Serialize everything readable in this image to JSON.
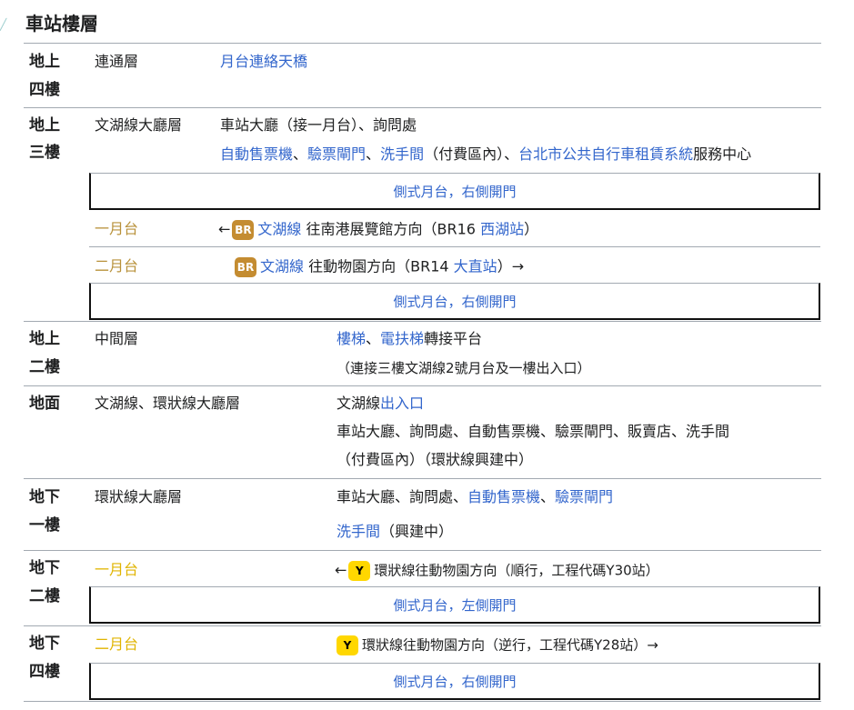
{
  "title": "車站樓層",
  "f4": {
    "floor_a": "地上",
    "floor_b": "四樓",
    "level": "連通層",
    "desc": "月台連絡天橋"
  },
  "f3": {
    "floor_a": "地上",
    "floor_b": "三樓",
    "level": "文湖線大廳層",
    "line1": "車站大廳（接一月台）、詢問處",
    "line2_links": [
      "自動售票機",
      "驗票閘門",
      "洗手間"
    ],
    "line2_sep1": "、",
    "line2_sep2": "、",
    "line2_plain1": "（付費區內）、",
    "line2_link4": "台北市公共自行車租賃系統",
    "line2_tail": "服務中心",
    "box1": "側式月台，右側開門",
    "p1_label": "一月台",
    "p1_arrow": "←",
    "p1_badge": "BR",
    "p1_line": "文湖線",
    "p1_dir": "往南港展覽館方向（BR16",
    "p1_station": "西湖站",
    "p1_end": "）",
    "p2_label": "二月台",
    "p2_badge": "BR",
    "p2_line": "文湖線",
    "p2_dir": "往動物園方向（BR14",
    "p2_station": "大直站",
    "p2_end": "）→",
    "box2": "側式月台，右側開門"
  },
  "f2": {
    "floor_a": "地上",
    "floor_b": "二樓",
    "level": "中間層",
    "desc_link1": "樓梯",
    "desc_sep": "、",
    "desc_link2": "電扶梯",
    "desc_tail": "轉接平台",
    "desc2": "（連接三樓文湖線2號月台及一樓出入口）"
  },
  "g": {
    "floor": "地面",
    "level": "文湖線、環狀線大廳層",
    "desc1_plain": "文湖線",
    "desc1_link": "出入口",
    "desc2": "車站大廳、詢問處、自動售票機、驗票閘門、販賣店、洗手間",
    "desc3": "（付費區內）（環狀線興建中）"
  },
  "b1": {
    "floor_a": "地下",
    "floor_b": "一樓",
    "level": "環狀線大廳層",
    "desc1_plain": "車站大廳、詢問處、",
    "desc1_link1": "自動售票機",
    "desc1_sep": "、",
    "desc1_link2": "驗票閘門",
    "desc2_link": "洗手間",
    "desc2_tail": "（興建中）"
  },
  "b2": {
    "floor_a": "地下",
    "floor_b": "二樓",
    "p_label": "一月台",
    "arrow": "←",
    "badge": "Y",
    "text": "環狀線往動物園方向（順行，工程代碼Y30站）",
    "box": "側式月台，左側開門"
  },
  "b4": {
    "floor_a": "地下",
    "floor_b": "四樓",
    "p_label": "二月台",
    "badge": "Y",
    "text": "環狀線往動物園方向（逆行，工程代碼Y28站）→",
    "box": "側式月台，右側開門"
  },
  "colors": {
    "link": "#3366cc",
    "br_badge": "#c48c31",
    "y_badge": "#ffd700",
    "gold": "#b8913a",
    "yellow": "#e0b400"
  }
}
